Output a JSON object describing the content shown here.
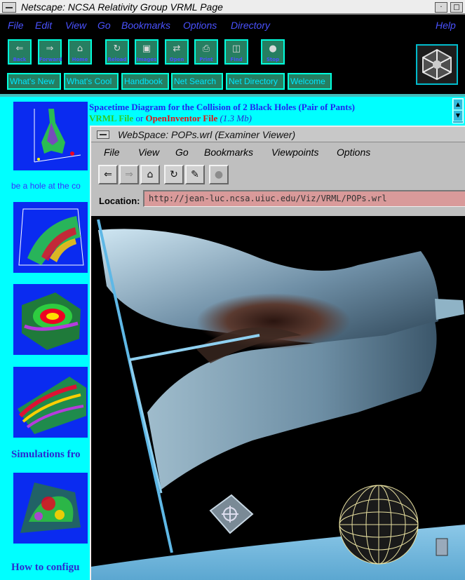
{
  "netscape": {
    "window_title": "Netscape: NCSA Relativity Group VRML Page",
    "menu": [
      "File",
      "Edit",
      "View",
      "Go",
      "Bookmarks",
      "Options",
      "Directory",
      "Help"
    ],
    "toolbar": [
      {
        "label": "Back",
        "icon": "back-arrow-icon"
      },
      {
        "label": "Forward",
        "icon": "forward-arrow-icon"
      },
      {
        "label": "Home",
        "icon": "home-icon"
      },
      {
        "label": "Reload",
        "icon": "reload-icon"
      },
      {
        "label": "Images",
        "icon": "images-icon"
      },
      {
        "label": "Open",
        "icon": "open-icon"
      },
      {
        "label": "Print",
        "icon": "print-icon"
      },
      {
        "label": "Find",
        "icon": "find-icon"
      },
      {
        "label": "Stop",
        "icon": "stop-icon"
      }
    ],
    "directory_buttons": [
      "What's New",
      "What's Cool",
      "Handbook",
      "Net Search",
      "Net Directory",
      "Welcome"
    ]
  },
  "page": {
    "heading": "Spacetime Diagram for the Collision of 2 Black Holes (Pair of Pants)",
    "link_vrml": "VRML File",
    "link_or": "or",
    "link_inventor": "OpenInventor File",
    "link_size": "(1.3 Mb)",
    "intro_fragment": "be a hole at the co",
    "section_simulations": "Simulations fro",
    "section_configure": "How to configu"
  },
  "webspace": {
    "window_title": "WebSpace: POPs.wrl (Examiner Viewer)",
    "menu": [
      "File",
      "View",
      "Go",
      "Bookmarks",
      "Viewpoints",
      "Options"
    ],
    "toolbar": [
      {
        "icon": "back-arrow-icon",
        "glyph": "⇐",
        "enabled": true
      },
      {
        "icon": "forward-arrow-icon",
        "glyph": "⇒",
        "enabled": false
      },
      {
        "icon": "home-icon",
        "glyph": "⌂",
        "enabled": true
      },
      {
        "icon": "reload-icon",
        "glyph": "↻",
        "enabled": true
      },
      {
        "icon": "viewer-tool-icon",
        "glyph": "✎",
        "enabled": true
      },
      {
        "icon": "stop-icon",
        "glyph": "●",
        "enabled": false
      }
    ],
    "location_label": "Location:",
    "location_url": "http://jean-luc.ncsa.uiuc.edu/Viz/VRML/POPs.wrl"
  },
  "colors": {
    "page_background": "#00ffff",
    "link_blue": "#1f26f0",
    "vrml_green": "#2fcb21",
    "inventor_red": "#e01515",
    "netscape_menu": "#4a52ff"
  }
}
